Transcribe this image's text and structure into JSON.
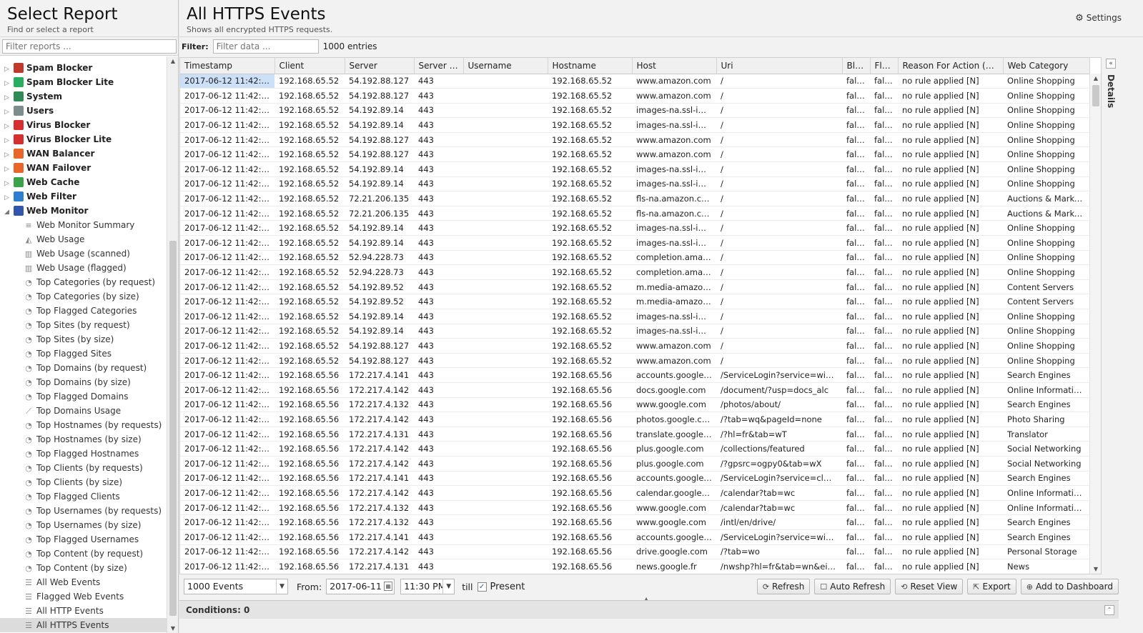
{
  "left": {
    "title": "Select Report",
    "subtitle": "Find or select a report",
    "filter_placeholder": "Filter reports ...",
    "apps": [
      {
        "label": "Spam Blocker",
        "icon": "spam-blocker-icon",
        "color": "#c0392b"
      },
      {
        "label": "Spam Blocker Lite",
        "icon": "spam-blocker-lite-icon",
        "color": "#27ae60"
      },
      {
        "label": "System",
        "icon": "system-icon",
        "color": "#2e8b57"
      },
      {
        "label": "Users",
        "icon": "users-icon",
        "color": "#7f8c8d"
      },
      {
        "label": "Virus Blocker",
        "icon": "virus-blocker-icon",
        "color": "#d62f2f"
      },
      {
        "label": "Virus Blocker Lite",
        "icon": "virus-blocker-lite-icon",
        "color": "#d62f2f"
      },
      {
        "label": "WAN Balancer",
        "icon": "wan-balancer-icon",
        "color": "#e8662a"
      },
      {
        "label": "WAN Failover",
        "icon": "wan-failover-icon",
        "color": "#e8662a"
      },
      {
        "label": "Web Cache",
        "icon": "web-cache-icon",
        "color": "#3aa34a"
      },
      {
        "label": "Web Filter",
        "icon": "web-filter-icon",
        "color": "#2f7fd1"
      },
      {
        "label": "Web Monitor",
        "icon": "web-monitor-icon",
        "color": "#3355aa"
      }
    ],
    "reports": [
      {
        "label": "Web Monitor Summary",
        "icon": "text-report-icon"
      },
      {
        "label": "Web Usage",
        "icon": "area-chart-icon"
      },
      {
        "label": "Web Usage (scanned)",
        "icon": "bar-chart-icon"
      },
      {
        "label": "Web Usage (flagged)",
        "icon": "bar-chart-icon"
      },
      {
        "label": "Top Categories (by request)",
        "icon": "pie-chart-icon"
      },
      {
        "label": "Top Categories (by size)",
        "icon": "pie-chart-icon"
      },
      {
        "label": "Top Flagged Categories",
        "icon": "pie-chart-icon"
      },
      {
        "label": "Top Sites (by request)",
        "icon": "pie-chart-icon"
      },
      {
        "label": "Top Sites (by size)",
        "icon": "pie-chart-icon"
      },
      {
        "label": "Top Flagged Sites",
        "icon": "pie-chart-icon"
      },
      {
        "label": "Top Domains (by request)",
        "icon": "pie-chart-icon"
      },
      {
        "label": "Top Domains (by size)",
        "icon": "pie-chart-icon"
      },
      {
        "label": "Top Flagged Domains",
        "icon": "pie-chart-icon"
      },
      {
        "label": "Top Domains Usage",
        "icon": "line-chart-icon"
      },
      {
        "label": "Top Hostnames (by requests)",
        "icon": "pie-chart-icon"
      },
      {
        "label": "Top Hostnames (by size)",
        "icon": "pie-chart-icon"
      },
      {
        "label": "Top Flagged Hostnames",
        "icon": "pie-chart-icon"
      },
      {
        "label": "Top Clients (by requests)",
        "icon": "pie-chart-icon"
      },
      {
        "label": "Top Clients (by size)",
        "icon": "pie-chart-icon"
      },
      {
        "label": "Top Flagged Clients",
        "icon": "pie-chart-icon"
      },
      {
        "label": "Top Usernames (by requests)",
        "icon": "pie-chart-icon"
      },
      {
        "label": "Top Usernames (by size)",
        "icon": "pie-chart-icon"
      },
      {
        "label": "Top Flagged Usernames",
        "icon": "pie-chart-icon"
      },
      {
        "label": "Top Content (by request)",
        "icon": "pie-chart-icon"
      },
      {
        "label": "Top Content (by size)",
        "icon": "pie-chart-icon"
      },
      {
        "label": "All Web Events",
        "icon": "list-icon"
      },
      {
        "label": "Flagged Web Events",
        "icon": "list-icon"
      },
      {
        "label": "All HTTP Events",
        "icon": "list-icon"
      },
      {
        "label": "All HTTPS Events",
        "icon": "list-icon",
        "selected": true
      }
    ]
  },
  "main": {
    "title": "All HTTPS Events",
    "subtitle": "Shows all encrypted HTTPS requests.",
    "settings_label": "Settings",
    "filter_label": "Filter:",
    "filter_placeholder": "Filter data ...",
    "entries_count": "1000 entries",
    "details_label": "Details",
    "columns": [
      "Timestamp",
      "Client",
      "Server",
      "Server P...",
      "Username",
      "Hostname",
      "Host",
      "Uri",
      "Blo...",
      "Fla...",
      "Reason For Action (We...",
      "Web Category"
    ],
    "rows": [
      [
        "2017-06-12 11:42:5...",
        "192.168.65.52",
        "54.192.88.127",
        "443",
        "",
        "192.168.65.52",
        "www.amazon.com",
        "/",
        "false",
        "false",
        "no rule applied [N]",
        "Online Shopping"
      ],
      [
        "2017-06-12 11:42:5...",
        "192.168.65.52",
        "54.192.88.127",
        "443",
        "",
        "192.168.65.52",
        "www.amazon.com",
        "/",
        "false",
        "false",
        "no rule applied [N]",
        "Online Shopping"
      ],
      [
        "2017-06-12 11:42:5...",
        "192.168.65.52",
        "54.192.89.14",
        "443",
        "",
        "192.168.65.52",
        "images-na.ssl-im...",
        "/",
        "false",
        "false",
        "no rule applied [N]",
        "Online Shopping"
      ],
      [
        "2017-06-12 11:42:5...",
        "192.168.65.52",
        "54.192.89.14",
        "443",
        "",
        "192.168.65.52",
        "images-na.ssl-im...",
        "/",
        "false",
        "false",
        "no rule applied [N]",
        "Online Shopping"
      ],
      [
        "2017-06-12 11:42:4...",
        "192.168.65.52",
        "54.192.88.127",
        "443",
        "",
        "192.168.65.52",
        "www.amazon.com",
        "/",
        "false",
        "false",
        "no rule applied [N]",
        "Online Shopping"
      ],
      [
        "2017-06-12 11:42:4...",
        "192.168.65.52",
        "54.192.88.127",
        "443",
        "",
        "192.168.65.52",
        "www.amazon.com",
        "/",
        "false",
        "false",
        "no rule applied [N]",
        "Online Shopping"
      ],
      [
        "2017-06-12 11:42:4...",
        "192.168.65.52",
        "54.192.89.14",
        "443",
        "",
        "192.168.65.52",
        "images-na.ssl-im...",
        "/",
        "false",
        "false",
        "no rule applied [N]",
        "Online Shopping"
      ],
      [
        "2017-06-12 11:42:4...",
        "192.168.65.52",
        "54.192.89.14",
        "443",
        "",
        "192.168.65.52",
        "images-na.ssl-im...",
        "/",
        "false",
        "false",
        "no rule applied [N]",
        "Online Shopping"
      ],
      [
        "2017-06-12 11:42:4...",
        "192.168.65.52",
        "72.21.206.135",
        "443",
        "",
        "192.168.65.52",
        "fls-na.amazon.com",
        "/",
        "false",
        "false",
        "no rule applied [N]",
        "Auctions & Marke..."
      ],
      [
        "2017-06-12 11:42:4...",
        "192.168.65.52",
        "72.21.206.135",
        "443",
        "",
        "192.168.65.52",
        "fls-na.amazon.com",
        "/",
        "false",
        "false",
        "no rule applied [N]",
        "Auctions & Marke..."
      ],
      [
        "2017-06-12 11:42:4...",
        "192.168.65.52",
        "54.192.89.14",
        "443",
        "",
        "192.168.65.52",
        "images-na.ssl-im...",
        "/",
        "false",
        "false",
        "no rule applied [N]",
        "Online Shopping"
      ],
      [
        "2017-06-12 11:42:4...",
        "192.168.65.52",
        "54.192.89.14",
        "443",
        "",
        "192.168.65.52",
        "images-na.ssl-im...",
        "/",
        "false",
        "false",
        "no rule applied [N]",
        "Online Shopping"
      ],
      [
        "2017-06-12 11:42:4...",
        "192.168.65.52",
        "52.94.228.73",
        "443",
        "",
        "192.168.65.52",
        "completion.amaz...",
        "/",
        "false",
        "false",
        "no rule applied [N]",
        "Online Shopping"
      ],
      [
        "2017-06-12 11:42:4...",
        "192.168.65.52",
        "52.94.228.73",
        "443",
        "",
        "192.168.65.52",
        "completion.amaz...",
        "/",
        "false",
        "false",
        "no rule applied [N]",
        "Online Shopping"
      ],
      [
        "2017-06-12 11:42:4...",
        "192.168.65.52",
        "54.192.89.52",
        "443",
        "",
        "192.168.65.52",
        "m.media-amazon...",
        "/",
        "false",
        "false",
        "no rule applied [N]",
        "Content Servers"
      ],
      [
        "2017-06-12 11:42:4...",
        "192.168.65.52",
        "54.192.89.52",
        "443",
        "",
        "192.168.65.52",
        "m.media-amazon...",
        "/",
        "false",
        "false",
        "no rule applied [N]",
        "Content Servers"
      ],
      [
        "2017-06-12 11:42:4...",
        "192.168.65.52",
        "54.192.89.14",
        "443",
        "",
        "192.168.65.52",
        "images-na.ssl-im...",
        "/",
        "false",
        "false",
        "no rule applied [N]",
        "Online Shopping"
      ],
      [
        "2017-06-12 11:42:4...",
        "192.168.65.52",
        "54.192.89.14",
        "443",
        "",
        "192.168.65.52",
        "images-na.ssl-im...",
        "/",
        "false",
        "false",
        "no rule applied [N]",
        "Online Shopping"
      ],
      [
        "2017-06-12 11:42:4...",
        "192.168.65.52",
        "54.192.88.127",
        "443",
        "",
        "192.168.65.52",
        "www.amazon.com",
        "/",
        "false",
        "false",
        "no rule applied [N]",
        "Online Shopping"
      ],
      [
        "2017-06-12 11:42:4...",
        "192.168.65.52",
        "54.192.88.127",
        "443",
        "",
        "192.168.65.52",
        "www.amazon.com",
        "/",
        "false",
        "false",
        "no rule applied [N]",
        "Online Shopping"
      ],
      [
        "2017-06-12 11:42:1...",
        "192.168.65.56",
        "172.217.4.141",
        "443",
        "",
        "192.168.65.56",
        "accounts.google....",
        "/ServiceLogin?service=wise...",
        "false",
        "false",
        "no rule applied [N]",
        "Search Engines"
      ],
      [
        "2017-06-12 11:42:1...",
        "192.168.65.56",
        "172.217.4.142",
        "443",
        "",
        "192.168.65.56",
        "docs.google.com",
        "/document/?usp=docs_alc",
        "false",
        "false",
        "no rule applied [N]",
        "Online Informatio..."
      ],
      [
        "2017-06-12 11:42:1...",
        "192.168.65.56",
        "172.217.4.132",
        "443",
        "",
        "192.168.65.56",
        "www.google.com",
        "/photos/about/",
        "false",
        "false",
        "no rule applied [N]",
        "Search Engines"
      ],
      [
        "2017-06-12 11:42:1...",
        "192.168.65.56",
        "172.217.4.142",
        "443",
        "",
        "192.168.65.56",
        "photos.google.co...",
        "/?tab=wq&pageId=none",
        "false",
        "false",
        "no rule applied [N]",
        "Photo Sharing"
      ],
      [
        "2017-06-12 11:42:1...",
        "192.168.65.56",
        "172.217.4.131",
        "443",
        "",
        "192.168.65.56",
        "translate.google.fr",
        "/?hl=fr&tab=wT",
        "false",
        "false",
        "no rule applied [N]",
        "Translator"
      ],
      [
        "2017-06-12 11:42:1...",
        "192.168.65.56",
        "172.217.4.142",
        "443",
        "",
        "192.168.65.56",
        "plus.google.com",
        "/collections/featured",
        "false",
        "false",
        "no rule applied [N]",
        "Social Networking"
      ],
      [
        "2017-06-12 11:42:1...",
        "192.168.65.56",
        "172.217.4.142",
        "443",
        "",
        "192.168.65.56",
        "plus.google.com",
        "/?gpsrc=ogpy0&tab=wX",
        "false",
        "false",
        "no rule applied [N]",
        "Social Networking"
      ],
      [
        "2017-06-12 11:42:1...",
        "192.168.65.56",
        "172.217.4.141",
        "443",
        "",
        "192.168.65.56",
        "accounts.google....",
        "/ServiceLogin?service=cl&p...",
        "false",
        "false",
        "no rule applied [N]",
        "Search Engines"
      ],
      [
        "2017-06-12 11:42:1...",
        "192.168.65.56",
        "172.217.4.142",
        "443",
        "",
        "192.168.65.56",
        "calendar.google.c...",
        "/calendar?tab=wc",
        "false",
        "false",
        "no rule applied [N]",
        "Online Informatio..."
      ],
      [
        "2017-06-12 11:42:1...",
        "192.168.65.56",
        "172.217.4.132",
        "443",
        "",
        "192.168.65.56",
        "www.google.com",
        "/calendar?tab=wc",
        "false",
        "false",
        "no rule applied [N]",
        "Online Informatio..."
      ],
      [
        "2017-06-12 11:42:1...",
        "192.168.65.56",
        "172.217.4.132",
        "443",
        "",
        "192.168.65.56",
        "www.google.com",
        "/intl/en/drive/",
        "false",
        "false",
        "no rule applied [N]",
        "Search Engines"
      ],
      [
        "2017-06-12 11:42:1...",
        "192.168.65.56",
        "172.217.4.141",
        "443",
        "",
        "192.168.65.56",
        "accounts.google....",
        "/ServiceLogin?service=wise...",
        "false",
        "false",
        "no rule applied [N]",
        "Search Engines"
      ],
      [
        "2017-06-12 11:42:1...",
        "192.168.65.56",
        "172.217.4.142",
        "443",
        "",
        "192.168.65.56",
        "drive.google.com",
        "/?tab=wo",
        "false",
        "false",
        "no rule applied [N]",
        "Personal Storage"
      ],
      [
        "2017-06-12 11:42:1...",
        "192.168.65.56",
        "172.217.4.131",
        "443",
        "",
        "192.168.65.56",
        "news.google.fr",
        "/nwshp?hl=fr&tab=wn&ei=...",
        "false",
        "false",
        "no rule applied [N]",
        "News"
      ]
    ]
  },
  "toolbar": {
    "limit_value": "1000 Events",
    "from_label": "From:",
    "from_date": "2017-06-11",
    "from_time": "11:30 PM",
    "till_label": "till",
    "present_label": "Present",
    "present_checked": true,
    "buttons": [
      {
        "label": "Refresh",
        "icon": "refresh-icon",
        "glyph": "⟳"
      },
      {
        "label": "Auto Refresh",
        "icon": "checkbox-icon",
        "glyph": "☐"
      },
      {
        "label": "Reset View",
        "icon": "reset-icon",
        "glyph": "⟲"
      },
      {
        "label": "Export",
        "icon": "export-icon",
        "glyph": "⇱"
      },
      {
        "label": "Add to Dashboard",
        "icon": "plus-circle-icon",
        "glyph": "⊕"
      }
    ]
  },
  "conditions": {
    "label": "Conditions: 0"
  }
}
